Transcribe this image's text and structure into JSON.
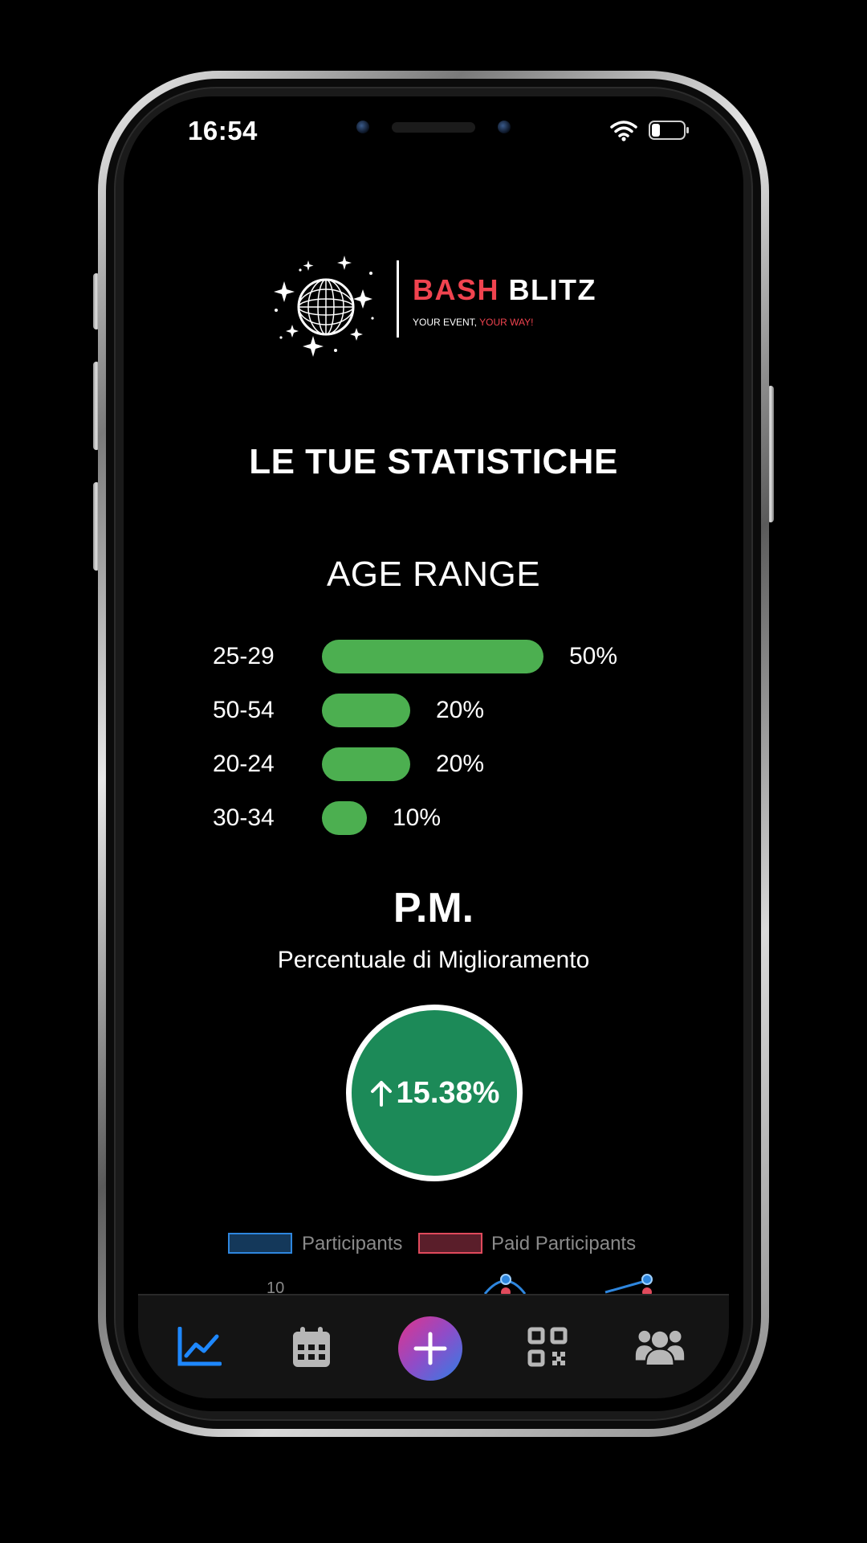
{
  "status_bar": {
    "time": "16:54"
  },
  "logo": {
    "brand_part1": "BASH",
    "brand_part2": "BLITZ",
    "tagline_part1": "YOUR EVENT, ",
    "tagline_part2": "YOUR WAY!"
  },
  "page_title": "LE TUE STATISTICHE",
  "age_range": {
    "title": "AGE RANGE",
    "rows": [
      {
        "label": "25-29",
        "value": "50%",
        "fraction": 0.5
      },
      {
        "label": "50-54",
        "value": "20%",
        "fraction": 0.2
      },
      {
        "label": "20-24",
        "value": "20%",
        "fraction": 0.2
      },
      {
        "label": "30-34",
        "value": "10%",
        "fraction": 0.1
      }
    ]
  },
  "pm": {
    "title": "P.M.",
    "subtitle": "Percentuale di Miglioramento",
    "value": "15.38%"
  },
  "chart_legend": {
    "series": [
      {
        "name": "Participants",
        "color": "#2e86de"
      },
      {
        "name": "Paid Participants",
        "color": "#e04a5c"
      }
    ],
    "y_tick_visible": "10"
  },
  "tabbar": {
    "items": [
      {
        "icon": "chart-line-icon",
        "active": true
      },
      {
        "icon": "calendar-icon",
        "active": false
      },
      {
        "icon": "plus-icon",
        "active": false
      },
      {
        "icon": "qr-code-icon",
        "active": false
      },
      {
        "icon": "users-icon",
        "active": false
      }
    ]
  },
  "colors": {
    "accent_red": "#f0434f",
    "bar_green": "#4caf50",
    "pm_green": "#1c8a58",
    "tab_active": "#1e88ff",
    "tab_inactive": "#b7b7b7"
  }
}
